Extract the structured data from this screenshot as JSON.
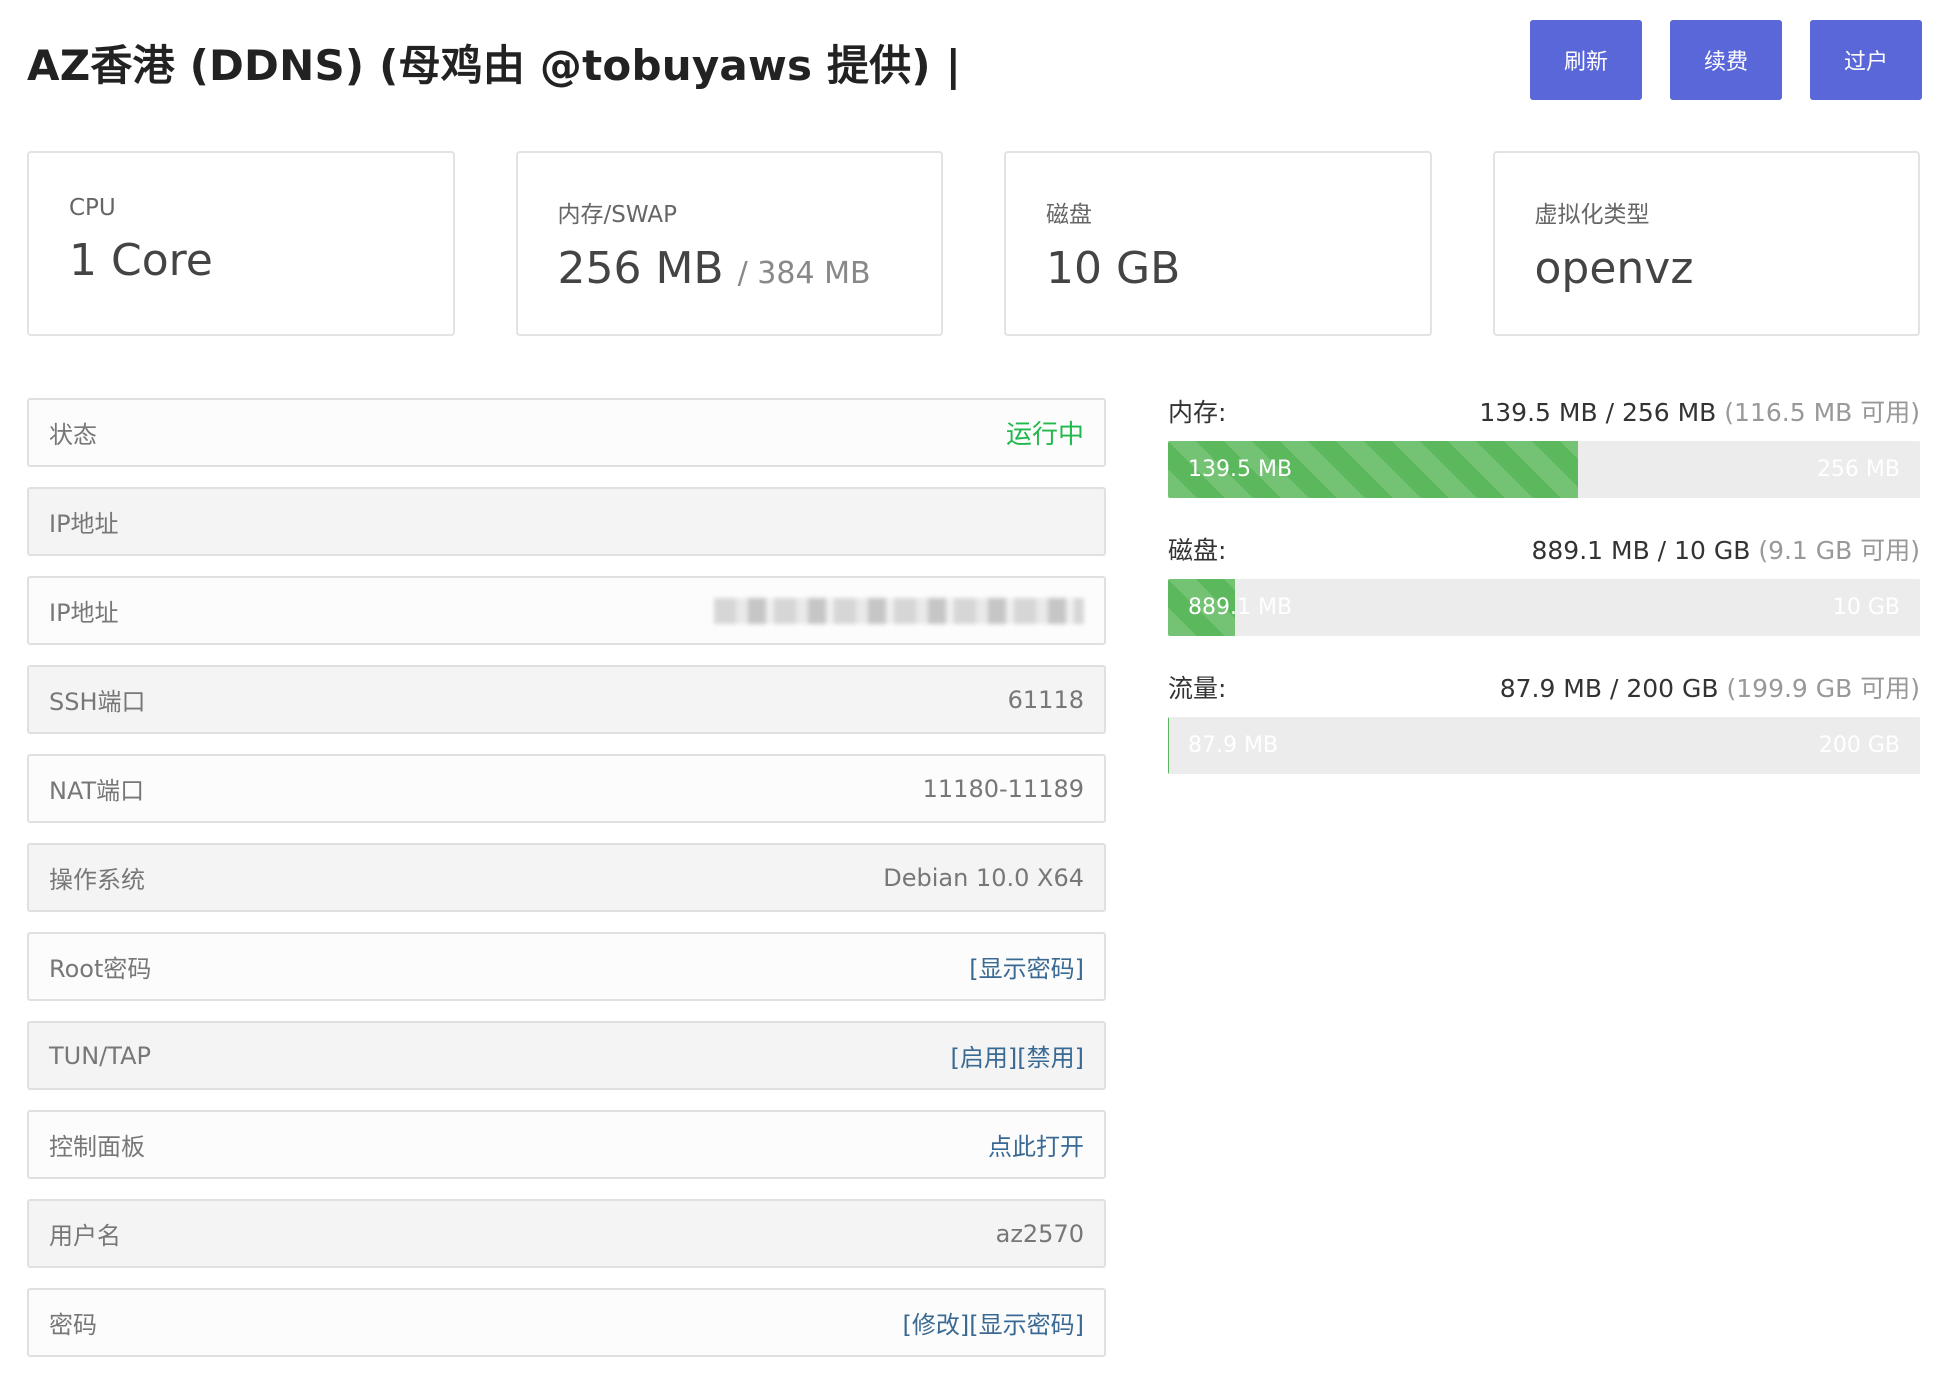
{
  "header": {
    "title": "AZ香港 (DDNS) (母鸡由 @tobuyaws 提供) |",
    "buttons": [
      {
        "label": "刷新"
      },
      {
        "label": "续费"
      },
      {
        "label": "过户"
      }
    ]
  },
  "specs": {
    "cpu": {
      "label": "CPU",
      "value": "1 Core"
    },
    "memory": {
      "label": "内存/SWAP",
      "value": "256 MB",
      "secondary": "/ 384 MB"
    },
    "disk": {
      "label": "磁盘",
      "value": "10 GB"
    },
    "virt": {
      "label": "虚拟化类型",
      "value": "openvz"
    }
  },
  "info": {
    "status": {
      "label": "状态",
      "value": "运行中"
    },
    "ip_a": {
      "label": "IP地址",
      "value": ""
    },
    "ip_b": {
      "label": "IP地址"
    },
    "ssh": {
      "label": "SSH端口",
      "value": "61118"
    },
    "nat": {
      "label": "NAT端口",
      "value": "11180-11189"
    },
    "os": {
      "label": "操作系统",
      "value": "Debian 10.0 X64"
    },
    "root": {
      "label": "Root密码",
      "action_show": "[显示密码]"
    },
    "tuntap": {
      "label": "TUN/TAP",
      "action_enable": "[启用]",
      "action_disable": "[禁用]"
    },
    "panel": {
      "label": "控制面板",
      "action_open": "点此打开"
    },
    "username": {
      "label": "用户名",
      "value": "az2570"
    },
    "password": {
      "label": "密码",
      "action_modify": "[修改]",
      "action_show": "[显示密码]"
    }
  },
  "usage": {
    "memory": {
      "title": "内存:",
      "used": "139.5 MB",
      "total": "256 MB",
      "free": "(116.5 MB 可用)",
      "fraction": 0.545
    },
    "disk": {
      "title": "磁盘:",
      "used": "889.1 MB",
      "total": "10 GB",
      "free": "(9.1 GB 可用)",
      "fraction": 0.089
    },
    "traffic": {
      "title": "流量:",
      "used": "87.9 MB",
      "total": "200 GB",
      "free": "(199.9 GB 可用)",
      "fraction": 0.0004
    }
  },
  "colors": {
    "primary_button": "#5a67d8",
    "status_running": "#22b84d",
    "link": "#3a6a93",
    "bar_fill": "#5cb85c"
  }
}
